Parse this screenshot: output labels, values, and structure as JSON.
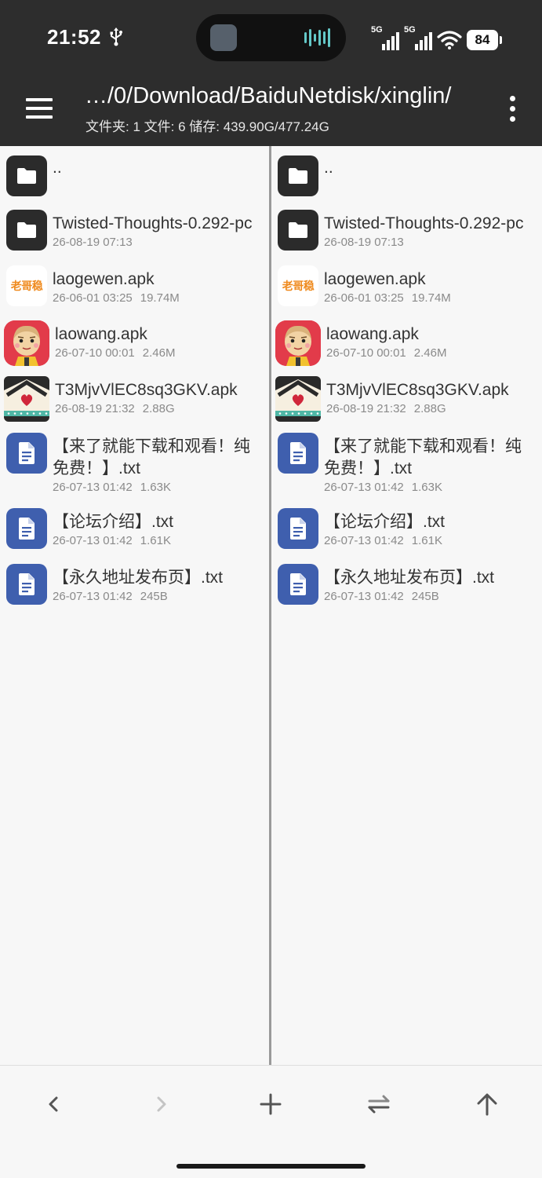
{
  "status_bar": {
    "time": "21:52",
    "network_1": "5G",
    "network_2": "5G",
    "battery": "84",
    "icons": [
      "usb-icon",
      "signal-icon",
      "wifi-icon",
      "battery-icon"
    ]
  },
  "app_bar": {
    "path": "…/0/Download/BaiduNetdisk/xinglin/",
    "info": "文件夹: 1  文件: 6  储存: 439.90G/477.24G",
    "menu_icon": "hamburger-menu-icon",
    "more_icon": "more-vert-icon"
  },
  "panes": {
    "left": {
      "items": [
        {
          "name": "..",
          "date": "",
          "size": "",
          "icon": "folder"
        },
        {
          "name": "Twisted-Thoughts-0.292-pc",
          "date": "26-08-19 07:13",
          "size": "",
          "icon": "folder"
        },
        {
          "name": "laogewen.apk",
          "date": "26-06-01 03:25",
          "size": "19.74M",
          "icon": "app-laogewen",
          "icon_text": "老哥稳"
        },
        {
          "name": "laowang.apk",
          "date": "26-07-10 00:01",
          "size": "2.46M",
          "icon": "app-laowang"
        },
        {
          "name": "T3MjvVlEC8sq3GKV.apk",
          "date": "26-08-19 21:32",
          "size": "2.88G",
          "icon": "app-t3"
        },
        {
          "name": "【来了就能下载和观看！纯免费！】.txt",
          "date": "26-07-13 01:42",
          "size": "1.63K",
          "icon": "document"
        },
        {
          "name": "【论坛介绍】.txt",
          "date": "26-07-13 01:42",
          "size": "1.61K",
          "icon": "document"
        },
        {
          "name": "【永久地址发布页】.txt",
          "date": "26-07-13 01:42",
          "size": "245B",
          "icon": "document"
        }
      ]
    },
    "right": {
      "items": [
        {
          "name": "..",
          "date": "",
          "size": "",
          "icon": "folder"
        },
        {
          "name": "Twisted-Thoughts-0.292-pc",
          "date": "26-08-19 07:13",
          "size": "",
          "icon": "folder"
        },
        {
          "name": "laogewen.apk",
          "date": "26-06-01 03:25",
          "size": "19.74M",
          "icon": "app-laogewen",
          "icon_text": "老哥稳"
        },
        {
          "name": "laowang.apk",
          "date": "26-07-10 00:01",
          "size": "2.46M",
          "icon": "app-laowang"
        },
        {
          "name": "T3MjvVlEC8sq3GKV.apk",
          "date": "26-08-19 21:32",
          "size": "2.88G",
          "icon": "app-t3"
        },
        {
          "name": "【来了就能下载和观看！纯免费！】.txt",
          "date": "26-07-13 01:42",
          "size": "1.63K",
          "icon": "document"
        },
        {
          "name": "【论坛介绍】.txt",
          "date": "26-07-13 01:42",
          "size": "1.61K",
          "icon": "document"
        },
        {
          "name": "【永久地址发布页】.txt",
          "date": "26-07-13 01:42",
          "size": "245B",
          "icon": "document"
        }
      ]
    }
  },
  "bottom_nav": {
    "buttons": [
      {
        "name": "back-button",
        "icon": "chevron-left-icon",
        "enabled": true
      },
      {
        "name": "forward-button",
        "icon": "chevron-right-icon",
        "enabled": false
      },
      {
        "name": "new-button",
        "icon": "plus-icon",
        "enabled": true
      },
      {
        "name": "swap-panes-button",
        "icon": "swap-icon",
        "enabled": true
      },
      {
        "name": "parent-dir-button",
        "icon": "arrow-up-icon",
        "enabled": true
      }
    ]
  },
  "colors": {
    "header": "#2d2d2d",
    "doc_icon": "#3f5fae",
    "folder_icon": "#2b2b2b",
    "name_text": "#333333",
    "meta_text": "#8a8a8a"
  }
}
